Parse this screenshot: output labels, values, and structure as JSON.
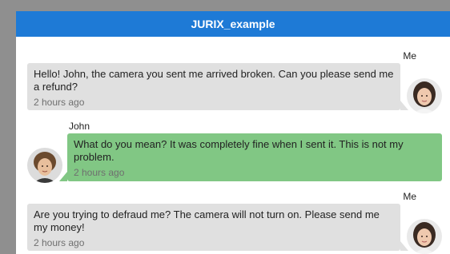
{
  "window": {
    "title": "JURIX_example"
  },
  "messages": [
    {
      "sender": "Me",
      "text": "Hello! John, the camera you sent me arrived broken. Can you please send me a refund?",
      "time": "2 hours ago"
    },
    {
      "sender": "John",
      "text": "What do you mean? It was completely fine when I sent it. This is not my problem.",
      "time": "2 hours ago"
    },
    {
      "sender": "Me",
      "text": "Are you trying to defraud me? The camera will not turn on. Please send me my money!",
      "time": "2 hours ago"
    }
  ],
  "colors": {
    "titlebar": "#1e7ad6",
    "me_bubble": "#e0e0e0",
    "john_bubble": "#81c784",
    "timestamp": "#6f6f6f"
  },
  "icons": [
    "avatar-woman-icon",
    "avatar-man-icon"
  ]
}
